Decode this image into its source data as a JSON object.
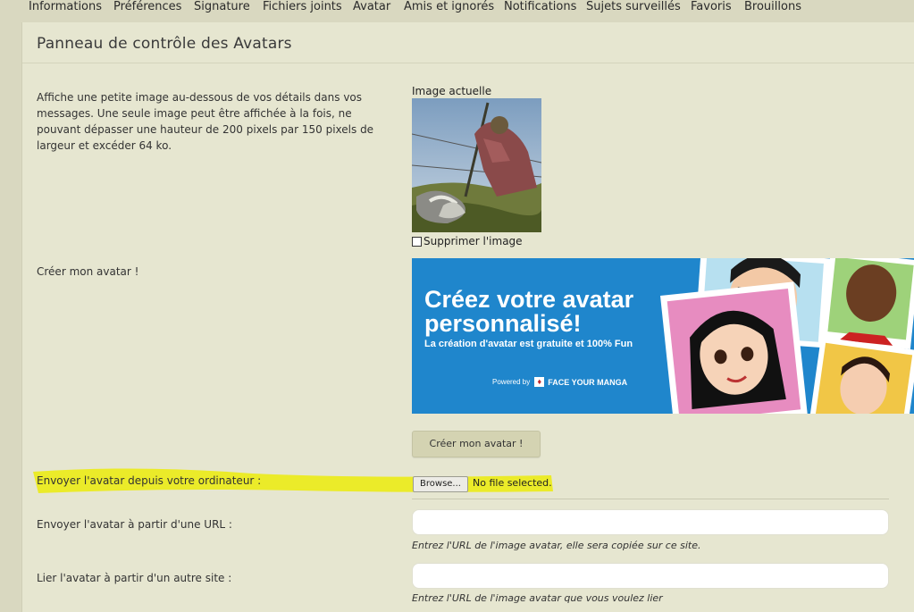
{
  "nav": {
    "tabs": [
      "Informations",
      "Préférences",
      "Signature",
      "Fichiers joints",
      "Avatar",
      "Amis et ignorés",
      "Notifications",
      "Sujets surveillés",
      "Favoris",
      "Brouillons"
    ]
  },
  "panel": {
    "title": "Panneau de contrôle des Avatars",
    "description": "Affiche une petite image au-dessous de vos détails dans vos messages. Une seule image peut être affichée à la fois, ne pouvant dépasser une hauteur de 200 pixels par 150 pixels de largeur et excéder 64 ko.",
    "current_image_label": "Image actuelle",
    "delete_label": "Supprimer l'image",
    "create_label": "Créer mon avatar !",
    "banner": {
      "line1": "Créez votre avatar",
      "line2": "personnalisé!",
      "subline": "La création d'avatar est gratuite et 100% Fun",
      "powered_by": "Powered by",
      "brand": "FACE YOUR MANGA"
    },
    "create_button": "Créer mon avatar !",
    "upload_label": "Envoyer l'avatar depuis votre ordinateur :",
    "browse_button": "Browse...",
    "no_file": "No file selected.",
    "url_label": "Envoyer l'avatar à partir d'une URL :",
    "url_value": "",
    "url_hint": "Entrez l'URL de l'image avatar, elle sera copiée sur ce site.",
    "link_label": "Lier l'avatar à partir d'un autre site :",
    "link_value": "",
    "link_hint": "Entrez l'URL de l'image avatar que vous voulez lier"
  },
  "colors": {
    "page_bg": "#d9d8c0",
    "panel_bg": "#e6e6d0",
    "banner_blue": "#1f86cc",
    "highlighter": "#ecec1a"
  }
}
